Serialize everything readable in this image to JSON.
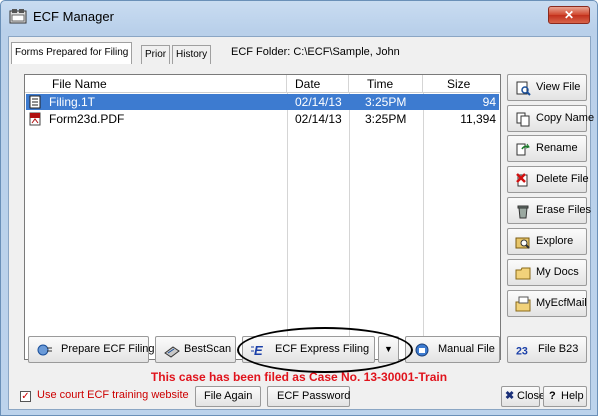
{
  "window": {
    "title": "ECF Manager",
    "close_label": "✕",
    "app_icon": "ecf-manager-icon"
  },
  "tabs": [
    {
      "label": "Forms Prepared for Filing",
      "active": true
    },
    {
      "label": "Prior",
      "active": false
    },
    {
      "label": "History",
      "active": false
    }
  ],
  "folder": {
    "label": "ECF Folder:",
    "path": "C:\\ECF\\Sample, John"
  },
  "file_list": {
    "columns": [
      "File Name",
      "Date",
      "Time",
      "Size"
    ],
    "rows": [
      {
        "name": "Filing.1T",
        "date": "02/14/13",
        "time": "3:25PM",
        "size": "94",
        "selected": true,
        "icon": "notepad-icon"
      },
      {
        "name": "Form23d.PDF",
        "date": "02/14/13",
        "time": "3:25PM",
        "size": "11,394",
        "selected": false,
        "icon": "pdf-icon"
      }
    ]
  },
  "side_buttons": [
    {
      "label": "View File",
      "icon": "view-file-icon"
    },
    {
      "label": "Copy Name",
      "icon": "copy-name-icon"
    },
    {
      "label": "Rename",
      "icon": "rename-icon"
    },
    {
      "label": "Delete File",
      "icon": "delete-file-icon"
    },
    {
      "label": "Erase Files",
      "icon": "erase-files-icon"
    },
    {
      "label": "Explore",
      "icon": "explore-icon"
    },
    {
      "label": "My Docs",
      "icon": "my-docs-icon"
    },
    {
      "label": "MyEcfMail",
      "icon": "my-ecf-mail-icon"
    }
  ],
  "bottom_buttons": {
    "prepare": "Prepare ECF Filing",
    "bestscan": "BestScan",
    "express": "ECF Express Filing",
    "dropdown": "▼",
    "manual": "Manual File",
    "b23": "File B23"
  },
  "status_message": "This case has been filed as Case No. 13-30001-Train",
  "footer": {
    "training_checkbox_label": "Use court ECF training website",
    "training_checked": true,
    "file_again": "File Again",
    "ecf_password": "ECF Password",
    "close": "Close",
    "help": "Help"
  },
  "colors": {
    "selection": "#3d7bd0",
    "status_red": "#e0131c",
    "title_bar": "#c9dcf1",
    "close_red": "#c2301c"
  }
}
